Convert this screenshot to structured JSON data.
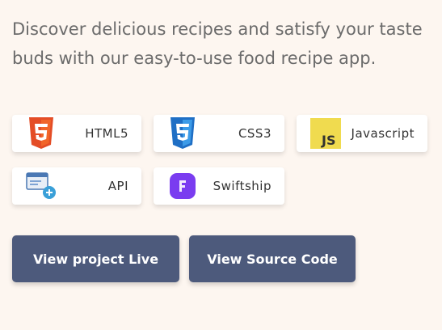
{
  "project": {
    "description": "Discover delicious recipes and satisfy your taste buds with our easy-to-use food recipe app."
  },
  "tech_stack": [
    {
      "label": "HTML5",
      "icon": "html5-icon",
      "color": "#e44d26"
    },
    {
      "label": "CSS3",
      "icon": "css3-icon",
      "color": "#2f7ed8"
    },
    {
      "label": "Javascript",
      "icon": "javascript-icon",
      "color": "#f0db4f"
    },
    {
      "label": "API",
      "icon": "api-icon",
      "color": "#3aa0d8"
    },
    {
      "label": "Swiftship",
      "icon": "swiftship-icon",
      "color": "#7a3cf0"
    }
  ],
  "actions": {
    "live_label": "View project Live",
    "source_label": "View Source Code"
  },
  "colors": {
    "background": "#fdf6f0",
    "button": "#4d5a7c",
    "text": "#6b6b6b"
  }
}
